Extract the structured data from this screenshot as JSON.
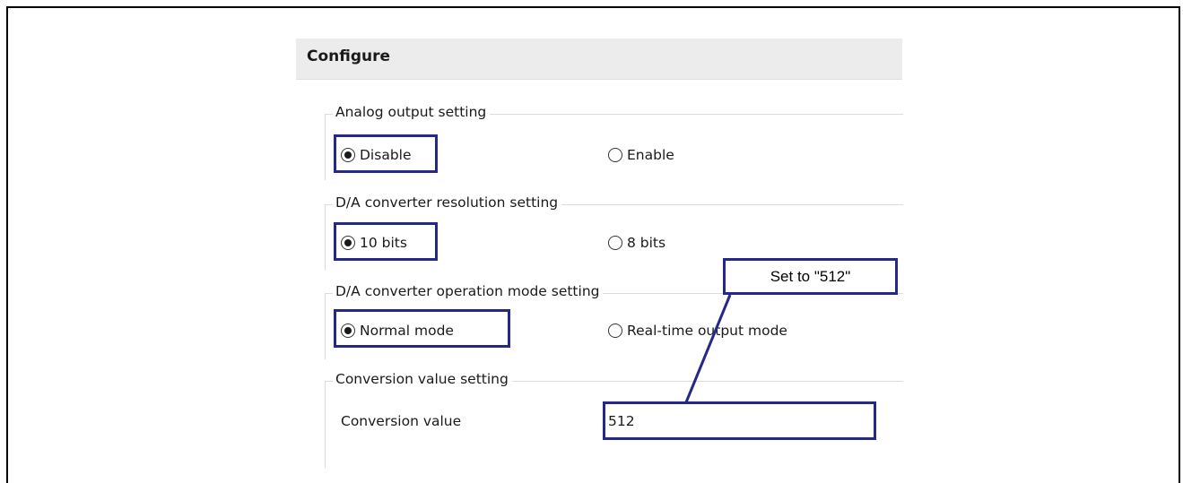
{
  "panel": {
    "title": "Configure"
  },
  "groups": {
    "analog": {
      "legend": "Analog output setting",
      "options": [
        {
          "label": "Disable",
          "selected": true
        },
        {
          "label": "Enable",
          "selected": false
        }
      ]
    },
    "resolution": {
      "legend": "D/A converter resolution setting",
      "options": [
        {
          "label": "10 bits",
          "selected": true
        },
        {
          "label": "8 bits",
          "selected": false
        }
      ]
    },
    "mode": {
      "legend": "D/A converter operation mode setting",
      "options": [
        {
          "label": "Normal mode",
          "selected": true
        },
        {
          "label": "Real-time output mode",
          "selected": false
        }
      ]
    },
    "conversion": {
      "legend": "Conversion value setting",
      "field_label": "Conversion value",
      "field_value": "512"
    }
  },
  "callout": {
    "text": "Set to \"512\""
  },
  "colors": {
    "highlight": "#262888",
    "header_bg": "#ececec"
  }
}
